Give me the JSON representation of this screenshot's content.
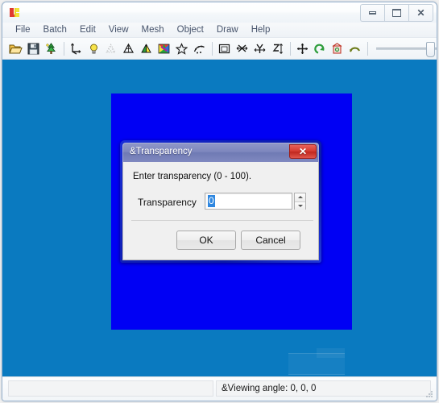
{
  "window": {
    "app_icon_name": "app-logo-icon",
    "controls": {
      "minimize_label": "Minimize",
      "maximize_label": "Maximize",
      "close_label": "Close"
    }
  },
  "menu": {
    "items": [
      {
        "label": "File"
      },
      {
        "label": "Batch"
      },
      {
        "label": "Edit"
      },
      {
        "label": "View"
      },
      {
        "label": "Mesh"
      },
      {
        "label": "Object"
      },
      {
        "label": "Draw"
      },
      {
        "label": "Help"
      }
    ]
  },
  "toolbar": {
    "groups": [
      {
        "buttons": [
          {
            "icon": "open-folder-icon"
          },
          {
            "icon": "save-disk-icon"
          },
          {
            "icon": "tree-green-icon"
          }
        ]
      },
      {
        "buttons": [
          {
            "icon": "axes-icon"
          },
          {
            "icon": "light-bulb-icon"
          },
          {
            "icon": "point-cloud-icon"
          },
          {
            "icon": "wireframe-cone-icon"
          },
          {
            "icon": "shaded-cone-icon"
          },
          {
            "icon": "color-palette-icon"
          },
          {
            "icon": "star-outline-icon"
          },
          {
            "icon": "curve-dots-icon"
          }
        ]
      },
      {
        "buttons": [
          {
            "icon": "bounding-box-icon"
          },
          {
            "icon": "scale-x-icon"
          },
          {
            "icon": "scale-y-icon"
          },
          {
            "icon": "scale-z-icon"
          }
        ]
      },
      {
        "buttons": [
          {
            "icon": "move-arrows-icon"
          },
          {
            "icon": "rotate-ccw-icon"
          },
          {
            "icon": "reset-view-icon"
          },
          {
            "icon": "undo-arc-icon"
          }
        ]
      }
    ],
    "slider": {
      "name": "zoom-slider",
      "value": 100
    }
  },
  "canvas": {
    "background_color": "#0a7ac0",
    "object_color": "#0000f4",
    "object_name": "blue-plane-object"
  },
  "status_bar": {
    "left_text": "",
    "right_text": "&Viewing angle: 0, 0, 0"
  },
  "dialog": {
    "title": "&Transparency",
    "close_glyph": "✕",
    "prompt": "Enter transparency (0 - 100).",
    "field_label": "Transparency",
    "field_value": "0",
    "field_placeholder": "",
    "spinner": {
      "up_label": "Increase",
      "down_label": "Decrease"
    },
    "buttons": {
      "ok": "OK",
      "cancel": "Cancel"
    },
    "accent_frame_color": "#1020b8",
    "selection_color": "#2f87e0"
  }
}
